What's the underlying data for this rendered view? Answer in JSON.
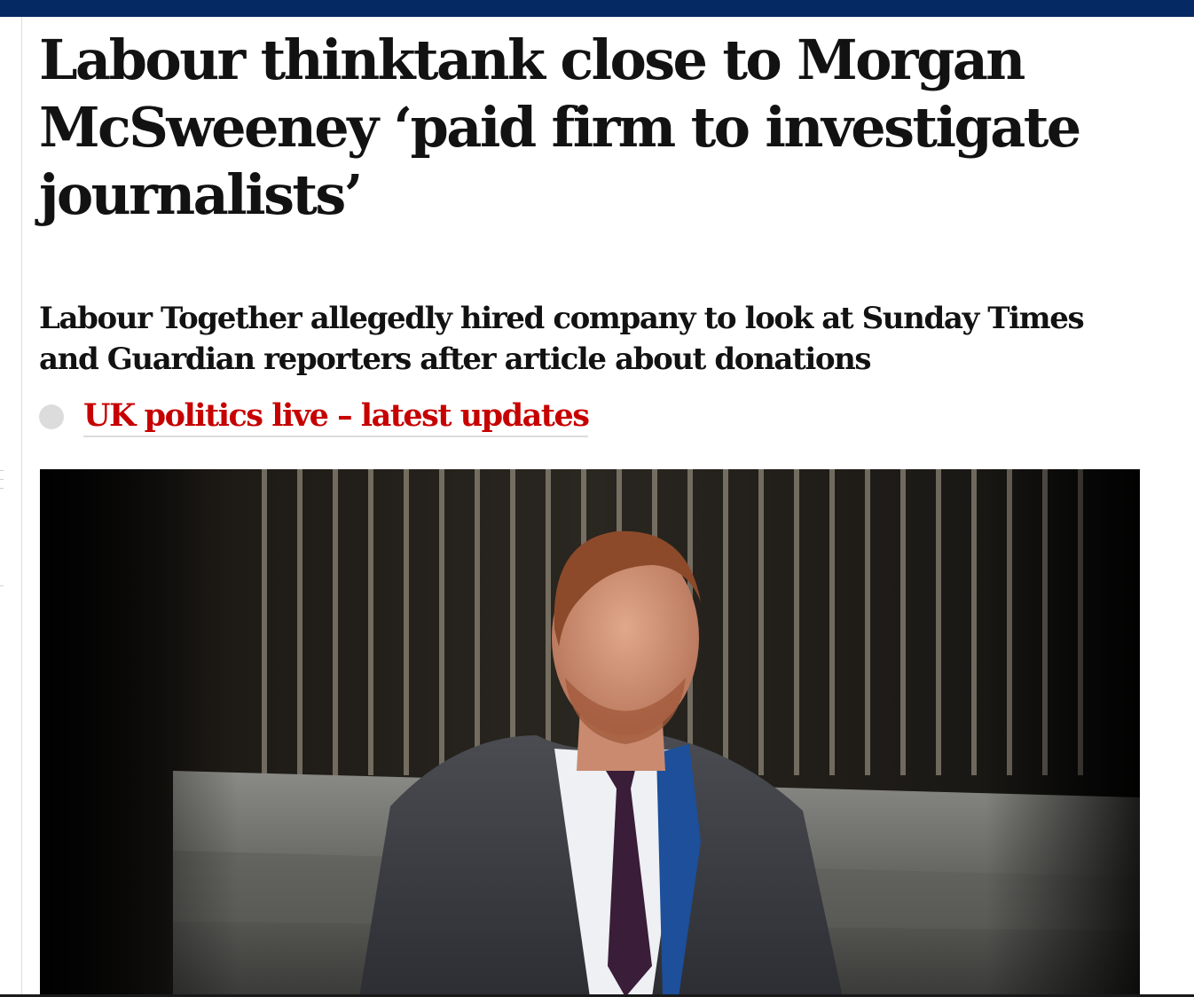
{
  "article": {
    "headline": "Labour thinktank close to Morgan McSweeney ‘paid firm to investigate journalists’",
    "standfirst": "Labour Together allegedly hired company to look at Sunday Times and Guardian reporters after article about donations",
    "live_link": {
      "label": "UK politics live – latest updates",
      "color": "#c70000"
    }
  },
  "colors": {
    "masthead": "#052962",
    "text": "#121212",
    "accent": "#c70000",
    "rule": "#dcdcdc"
  }
}
